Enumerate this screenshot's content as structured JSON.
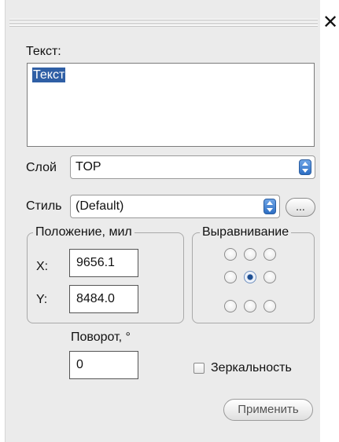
{
  "window": {
    "close_glyph": "✕"
  },
  "text_section": {
    "label": "Текст:",
    "value": "Текст"
  },
  "layer": {
    "label": "Слой",
    "selected": "TOP"
  },
  "style": {
    "label": "Стиль",
    "selected": "(Default)",
    "more_button": "..."
  },
  "position": {
    "title": "Положение, мил",
    "x_label": "X:",
    "x_value": "9656.1",
    "y_label": "Y:",
    "y_value": "8484.0"
  },
  "alignment": {
    "title": "Выравнивание",
    "grid": [
      [
        false,
        false,
        false
      ],
      [
        false,
        true,
        false
      ],
      [
        false,
        false,
        false
      ]
    ]
  },
  "rotation": {
    "label": "Поворот, °",
    "value": "0"
  },
  "mirror": {
    "label": "Зеркальность",
    "checked": false
  },
  "apply": {
    "label": "Применить"
  },
  "colors": {
    "selection": "#2f5fa5",
    "spin_button": "#2d6ec4",
    "panel_bg": "#ebebeb"
  }
}
